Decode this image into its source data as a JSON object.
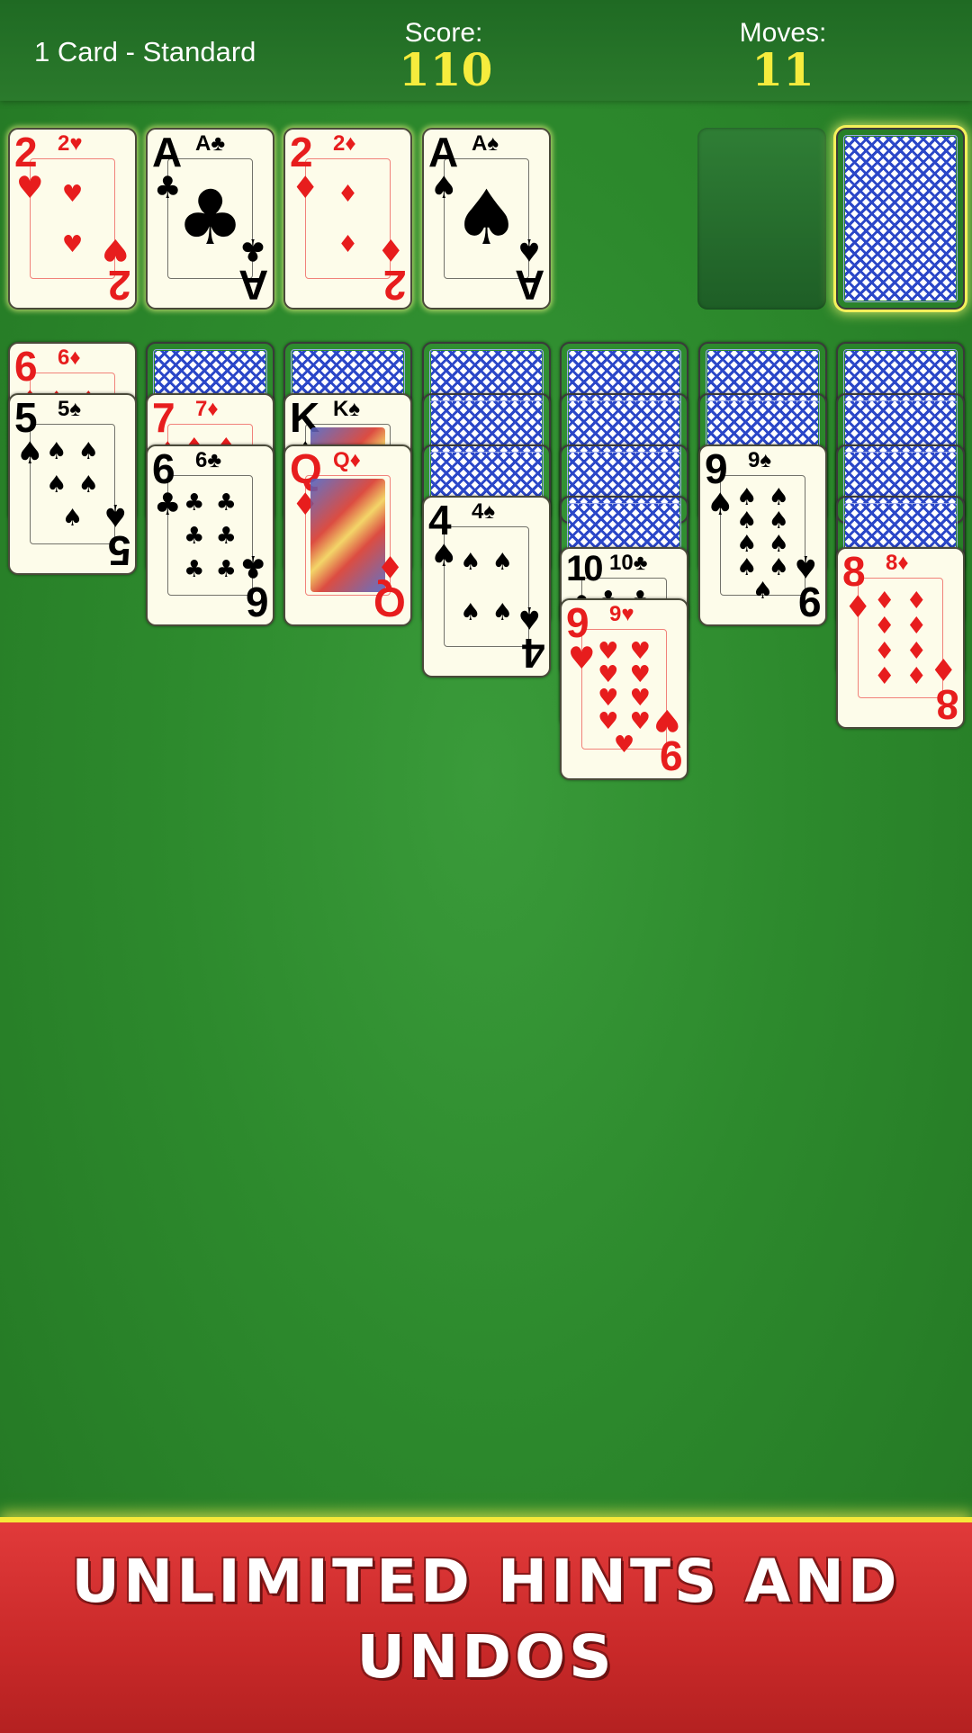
{
  "header": {
    "mode": "1 Card - Standard",
    "score_label": "Score:",
    "score_value": "110",
    "moves_label": "Moves:",
    "moves_value": "11"
  },
  "foundations": [
    {
      "rank": "2",
      "suit": "♥",
      "color": "red"
    },
    {
      "rank": "A",
      "suit": "♣",
      "color": "black"
    },
    {
      "rank": "2",
      "suit": "♦",
      "color": "red"
    },
    {
      "rank": "A",
      "suit": "♠",
      "color": "black"
    }
  ],
  "tableau": [
    {
      "hidden": 0,
      "cards": [
        {
          "rank": "6",
          "suit": "♦",
          "color": "red"
        },
        {
          "rank": "5",
          "suit": "♠",
          "color": "black"
        }
      ]
    },
    {
      "hidden": 1,
      "cards": [
        {
          "rank": "7",
          "suit": "♦",
          "color": "red"
        },
        {
          "rank": "6",
          "suit": "♣",
          "color": "black"
        }
      ]
    },
    {
      "hidden": 1,
      "cards": [
        {
          "rank": "K",
          "suit": "♠",
          "color": "black"
        },
        {
          "rank": "Q",
          "suit": "♦",
          "color": "red"
        }
      ]
    },
    {
      "hidden": 3,
      "cards": [
        {
          "rank": "4",
          "suit": "♠",
          "color": "black"
        }
      ]
    },
    {
      "hidden": 4,
      "cards": [
        {
          "rank": "10",
          "suit": "♣",
          "color": "black"
        },
        {
          "rank": "9",
          "suit": "♥",
          "color": "red"
        }
      ]
    },
    {
      "hidden": 2,
      "cards": [
        {
          "rank": "9",
          "suit": "♠",
          "color": "black"
        }
      ]
    },
    {
      "hidden": 4,
      "cards": [
        {
          "rank": "8",
          "suit": "♦",
          "color": "red"
        }
      ]
    }
  ],
  "banner": {
    "line1": "UNLIMITED HINTS AND",
    "line2": "UNDOS"
  },
  "colors": {
    "felt": "#2d8a2d",
    "red_suit": "#e71d1d",
    "banner": "#d42e2e",
    "score": "#f6ec3d"
  },
  "icons": {
    "stock": "card-back-icon"
  }
}
